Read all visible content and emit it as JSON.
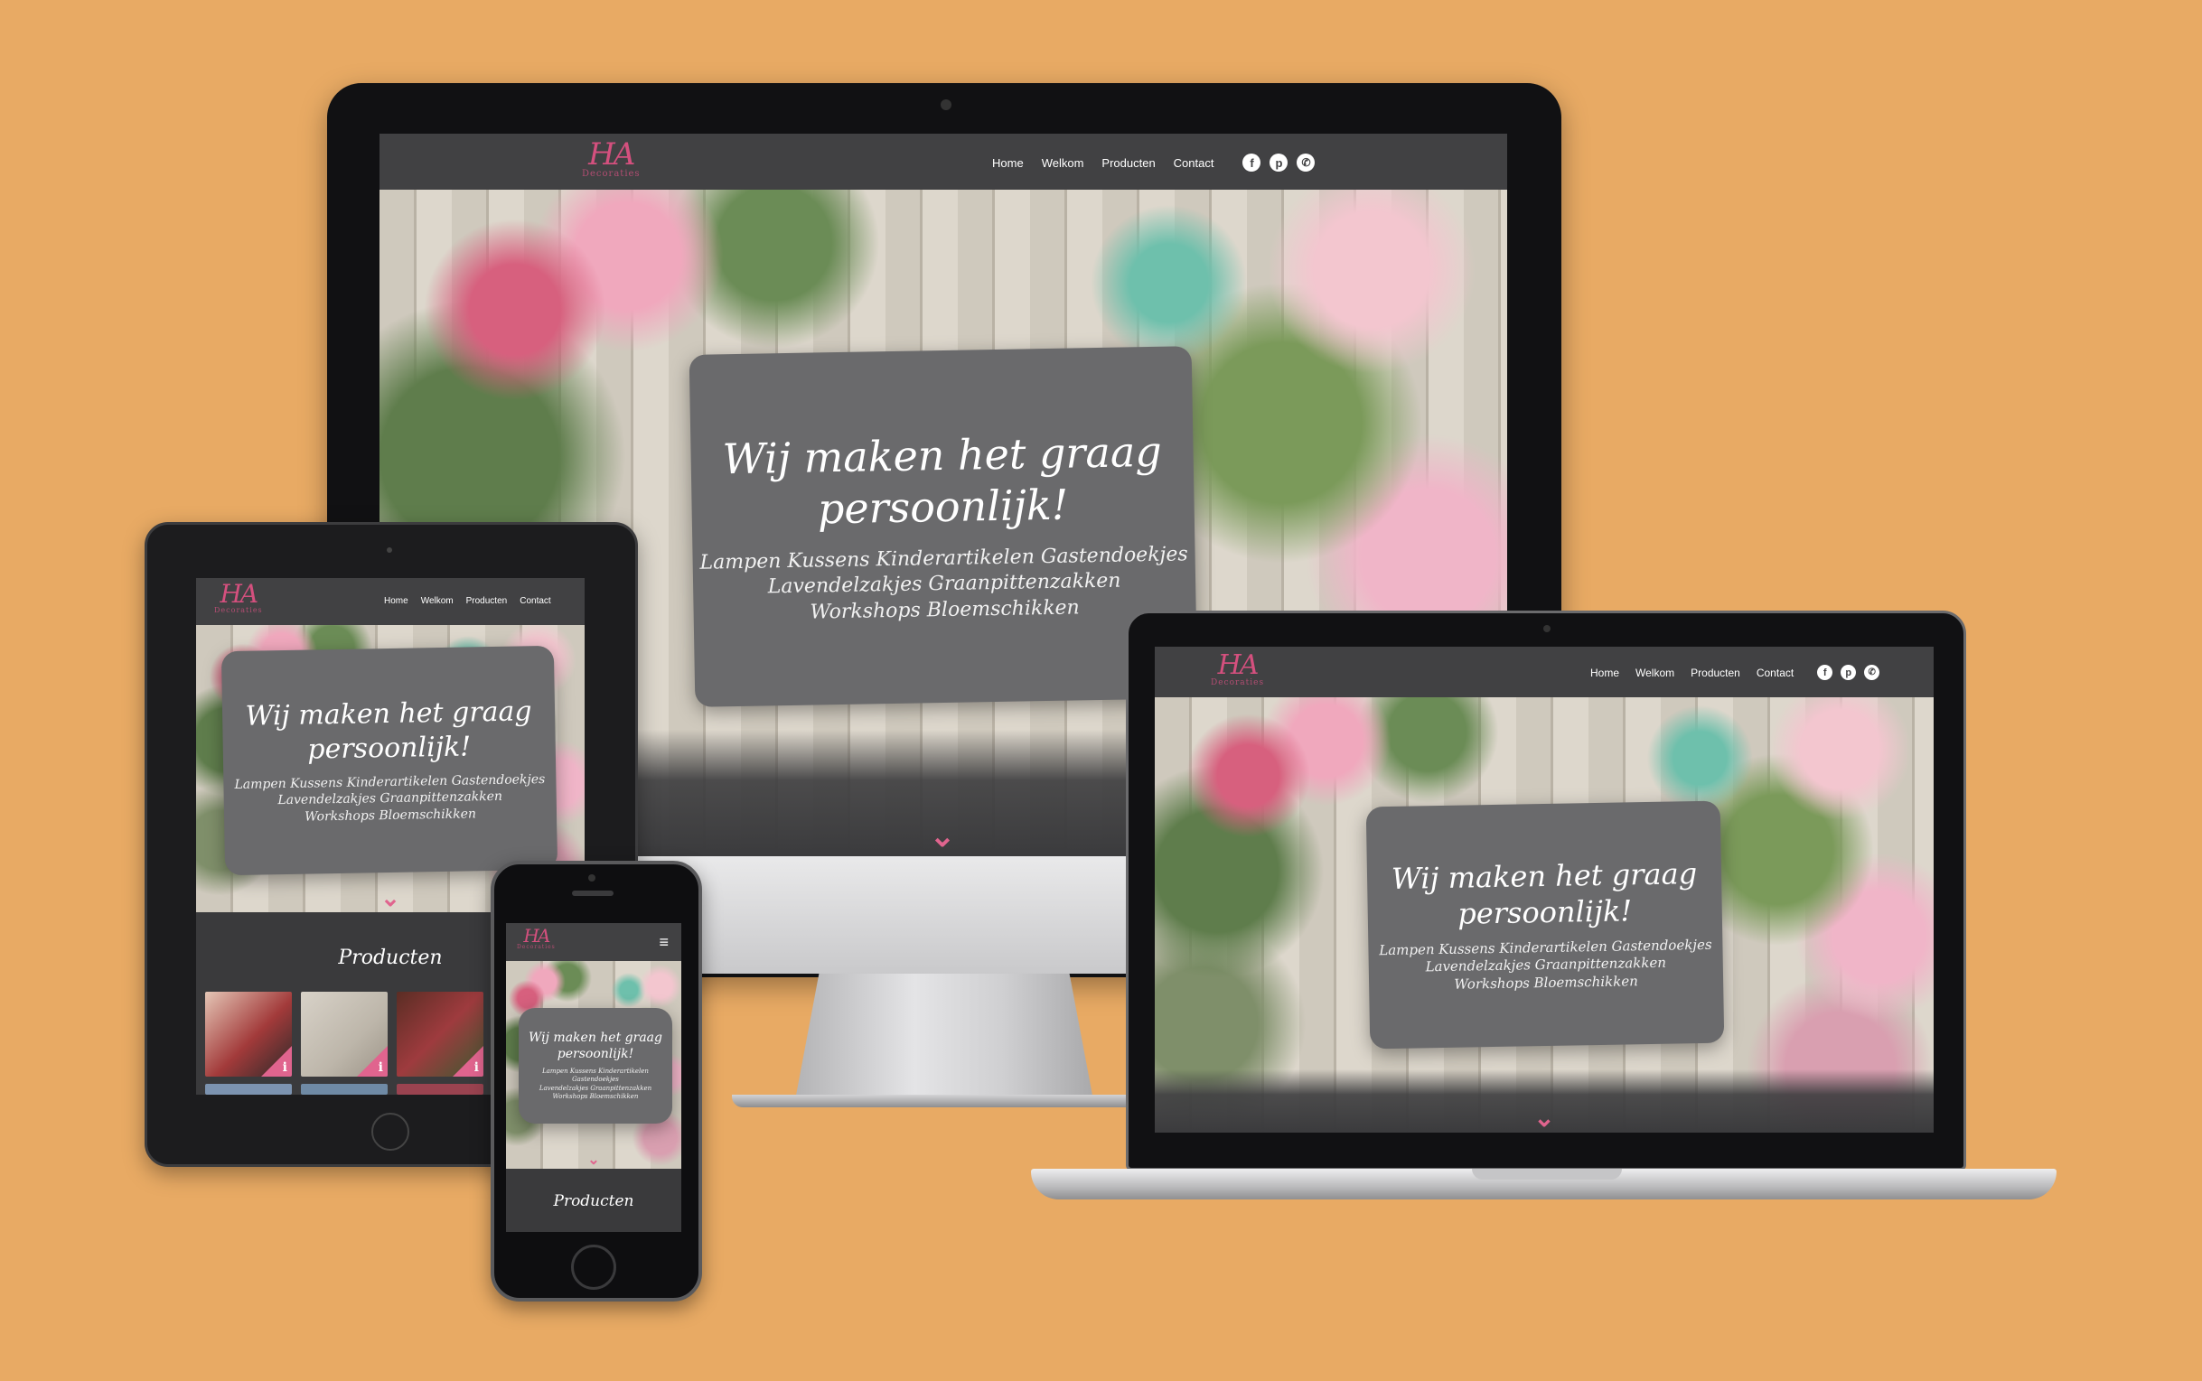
{
  "brand": {
    "logo_mark": "HA",
    "logo_sub": "Decoraties"
  },
  "nav": {
    "items": [
      "Home",
      "Welkom",
      "Producten",
      "Contact"
    ],
    "social_icons": [
      "facebook-icon",
      "pinterest-icon",
      "whatsapp-icon"
    ]
  },
  "hero": {
    "headline_line1": "Wij maken het graag",
    "headline_line2": "persoonlijk!",
    "products_line1": "Lampen Kussens Kinderartikelen Gastendoekjes",
    "products_line2": "Lavendelzakjes Graanpittenzakken",
    "products_line3": "Workshops Bloemschikken"
  },
  "sections": {
    "products_title": "Producten"
  },
  "colors": {
    "background": "#e8aa64",
    "nav": "#414143",
    "accent_pink": "#e0648e"
  }
}
